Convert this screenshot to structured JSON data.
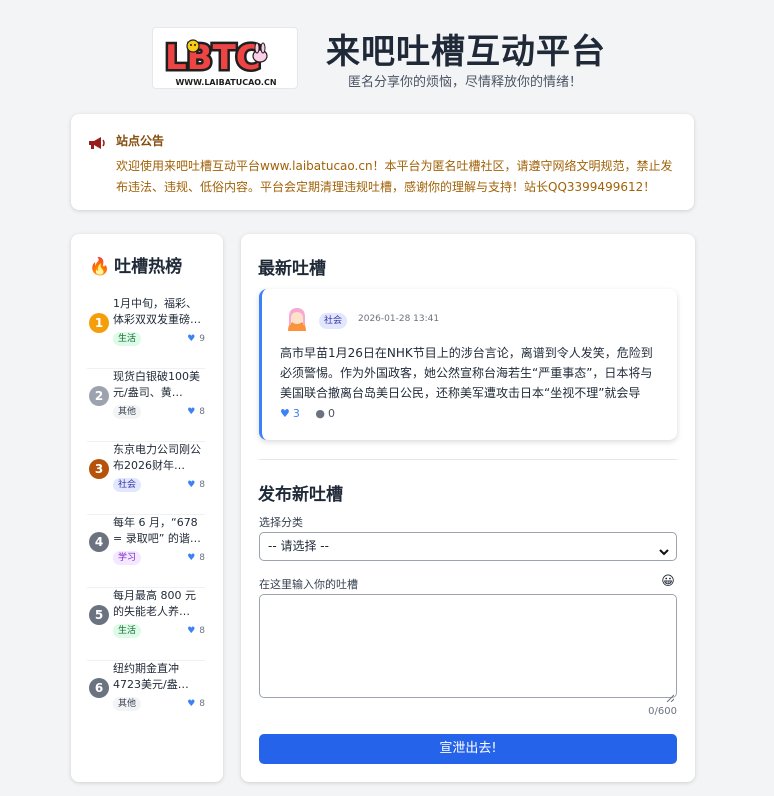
{
  "header": {
    "logo_text": "LBTC",
    "logo_url_text": "WWW.LAIBATUCAO.CN",
    "title": "来吧吐槽互动平台",
    "subtitle": "匿名分享你的烦恼，尽情释放你的情绪！"
  },
  "announcement": {
    "icon": "megaphone-icon",
    "title": "站点公告",
    "text": "欢迎使用来吧吐槽互动平台www.laibatucao.cn！本平台为匿名吐槽社区，请遵守网络文明规范，禁止发布违法、违规、低俗内容。平台会定期清理违规吐槽，感谢你的理解与支持！站长QQ3399499612！"
  },
  "sidebar": {
    "title_icon": "🔥",
    "title": "吐槽热榜",
    "items": [
      {
        "rank": "1",
        "title": "1月中旬，福彩、体彩双双发重磅…",
        "tag": "生活",
        "likes": "9"
      },
      {
        "rank": "2",
        "title": "现货白银破100美元/盎司、黄…",
        "tag": "其他",
        "likes": "8"
      },
      {
        "rank": "3",
        "title": "东京电力公司刚公布2026财年…",
        "tag": "社会",
        "likes": "8"
      },
      {
        "rank": "4",
        "title": "每年 6 月，“678 = 录取吧” 的谐…",
        "tag": "学习",
        "likes": "8"
      },
      {
        "rank": "5",
        "title": "每月最高 800 元的失能老人养…",
        "tag": "生活",
        "likes": "8"
      },
      {
        "rank": "6",
        "title": "纽约期金直冲4723美元/盎…",
        "tag": "其他",
        "likes": "8"
      }
    ]
  },
  "latest": {
    "title": "最新吐槽",
    "post": {
      "tag": "社会",
      "time": "2026-01-28 13:41",
      "body": "高市早苗1月26日在NHK节目上的涉台言论，离谱到令人发笑，危险到必须警惕。作为外国政客，她公然宣称台海若生“严重事态”，日本将与美国联合撤离台岛美日公民，还称美军遭攻击日本“坐视不理”就会导致…",
      "likes": "3",
      "comments": "0"
    }
  },
  "form": {
    "title": "发布新吐槽",
    "category_label": "选择分类",
    "category_value": "-- 请选择 --",
    "content_label": "在这里输入你的吐槽",
    "emoji": "😀",
    "char_count": "0/600",
    "submit_label": "宣泄出去!"
  },
  "colors": {
    "primary": "#2563eb",
    "announce_title": "#854d0e",
    "announce_text": "#a16207"
  }
}
